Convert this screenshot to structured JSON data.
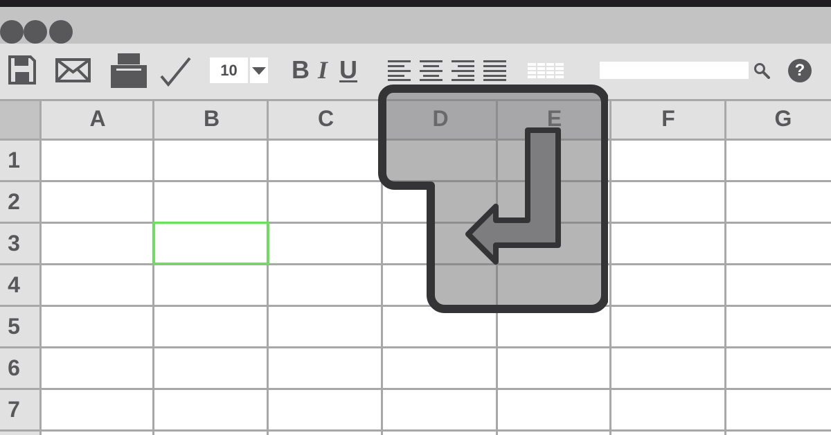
{
  "window": {
    "controls": [
      "close",
      "minimize",
      "maximize"
    ]
  },
  "toolbar": {
    "icons": {
      "save": "floppy-disk-icon",
      "mail": "envelope-icon",
      "print": "printer-icon",
      "check": "checkmark-icon",
      "align_left": "align-left-icon",
      "align_center": "align-center-icon",
      "align_right": "align-right-icon",
      "justify": "justify-icon",
      "table": "table-icon",
      "search": "search-icon",
      "help": "help-icon"
    },
    "font_size": "10",
    "bold_label": "B",
    "italic_label": "I",
    "underline_label": "U",
    "search": {
      "value": "",
      "placeholder": ""
    },
    "help_label": "?"
  },
  "sheet": {
    "columns": [
      "A",
      "B",
      "C",
      "D",
      "E",
      "F",
      "G"
    ],
    "rows": [
      "1",
      "2",
      "3",
      "4",
      "5",
      "6",
      "7"
    ],
    "selected_cell": "B3",
    "selection_color": "#5ceb4a"
  },
  "overlay": {
    "icon": "enter-return-key-icon"
  },
  "colors": {
    "dark": "#58585a",
    "grid_line": "#a8a8a9",
    "header_bg": "#e1e1e2",
    "titlebar_bg": "#c3c3c4",
    "selection": "#5ceb4a"
  }
}
